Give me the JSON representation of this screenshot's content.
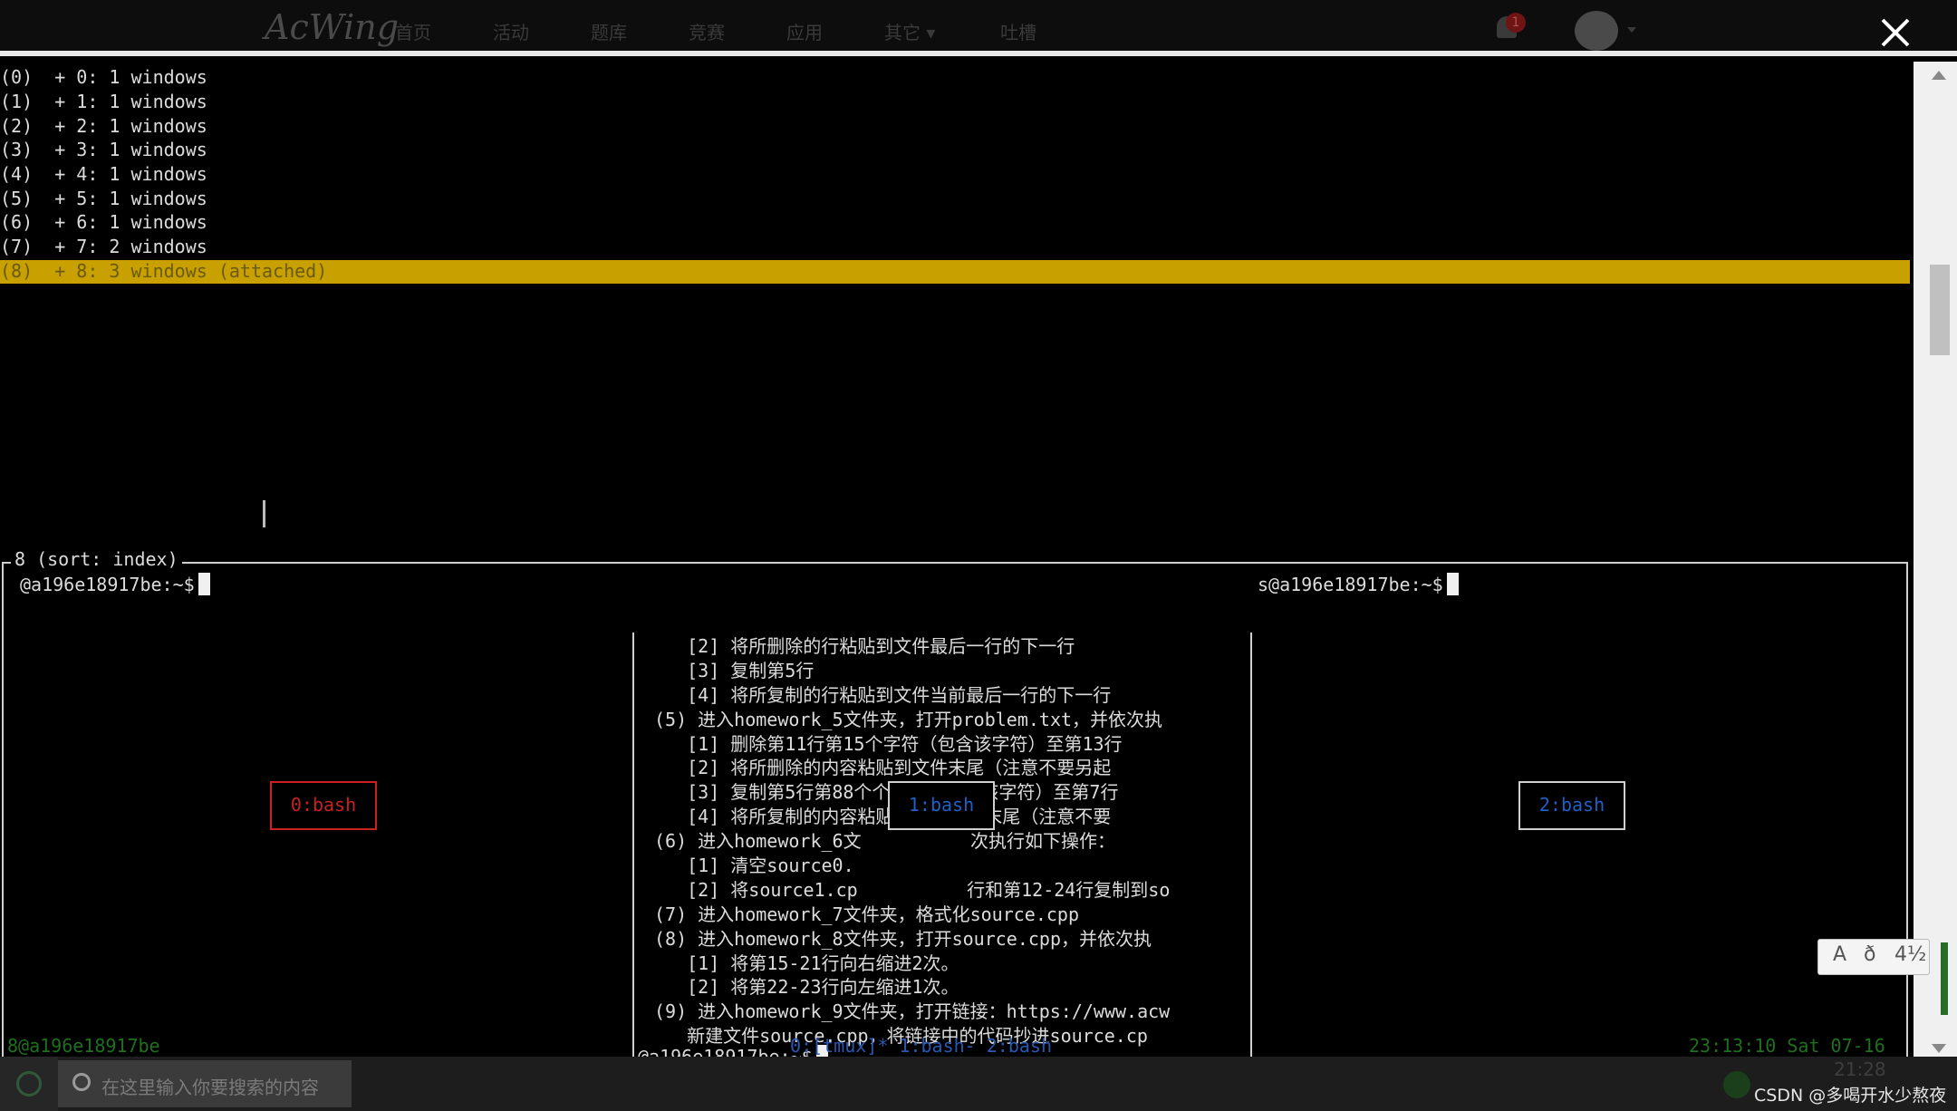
{
  "nav": {
    "brand": "AcWing",
    "items": [
      "首页",
      "活动",
      "题库",
      "竞赛",
      "应用",
      "其它 ▾",
      "吐槽"
    ],
    "notification_count": "1",
    "close_label": "×"
  },
  "sessions": [
    "(0)  + 0: 1 windows",
    "(1)  + 1: 1 windows",
    "(2)  + 2: 1 windows",
    "(3)  + 3: 1 windows",
    "(4)  + 4: 1 windows",
    "(5)  + 5: 1 windows",
    "(6)  + 6: 1 windows",
    "(7)  + 7: 2 windows",
    "(8)  + 8: 3 windows (attached)"
  ],
  "preview": {
    "box_label": " 8 (sort: index)",
    "left_prompt": "@a196e18917be:~$",
    "right_prompt": "s@a196e18917be:~$",
    "mid_prompt": "@a196e18917be:~$",
    "window_labels": [
      "0:bash",
      "1:bash",
      "2:bash"
    ],
    "mid_lines": [
      "   [2] 将所删除的行粘贴到文件最后一行的下一行",
      "   [3] 复制第5行",
      "   [4] 将所复制的行粘贴到文件当前最后一行的下一行",
      "(5) 进入homework_5文件夹，打开problem.txt，并依次执",
      "   [1] 删除第11行第15个字符（包含该字符）至第13行",
      "   [2] 将所删除的内容粘贴到文件末尾（注意不要另起",
      "   [3] 复制第5行第88个个字符（包含该字符）至第7行",
      "   [4] 将所复制的内容粘贴到当前文件末尾（注意不要",
      "(6) 进入homework_6文          次执行如下操作：",
      "   [1] 清空source0.",
      "   [2] 将source1.cp          行和第12-24行复制到so",
      "(7) 进入homework_7文件夹，格式化source.cpp",
      "(8) 进入homework_8文件夹，打开source.cpp，并依次执",
      "   [1] 将第15-21行向右缩进2次。",
      "   [2] 将第22-23行向左缩进1次。",
      "(9) 进入homework_9文件夹，打开链接：https://www.acw",
      "   新建文件source.cpp，将链接中的代码抄进source.cp"
    ]
  },
  "status": {
    "left": "8@a196e18917be",
    "middle": "0:[tmux]* 1:bash- 2:bash",
    "right": "23:13:10 Sat 07-16"
  },
  "taskbar": {
    "search_placeholder": "在这里输入你要搜索的内容",
    "time": "21:28",
    "watermark": "CSDN @多喝开水少熬夜"
  },
  "ime": [
    "A",
    "ð",
    "4½"
  ],
  "colors": {
    "highlight": "#c8a000",
    "window_red": "#cc2020",
    "window_blue": "#2060c8",
    "status_green": "#1f6f1f"
  }
}
